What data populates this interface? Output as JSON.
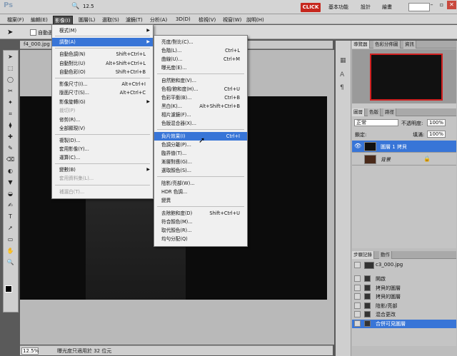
{
  "app": {
    "logo": "Ps",
    "zoom_value": "12.5",
    "click_label": "CLICK",
    "workspaces": [
      "基本功能",
      "設計",
      "繪畫"
    ]
  },
  "menubar": [
    "檔案(F)",
    "編輯(E)",
    "影像(I)",
    "圖層(L)",
    "選取(S)",
    "濾鏡(T)",
    "分析(A)",
    "3D(D)",
    "檢視(V)",
    "視窗(W)",
    "說明(H)"
  ],
  "options": {
    "auto_select": "自動選"
  },
  "document": {
    "tab": "f4_000.jpg @",
    "zoom": "12.5%",
    "status": "曝光度只適用於 32 位元"
  },
  "image_menu": [
    {
      "label": "模式(M)",
      "shortcut": "",
      "sub": true
    },
    {
      "label": "調整(A)",
      "shortcut": "",
      "sub": true,
      "hl": true
    },
    {
      "label": "自動色調(N)",
      "shortcut": "Shift+Ctrl+L"
    },
    {
      "label": "自動對比(U)",
      "shortcut": "Alt+Shift+Ctrl+L"
    },
    {
      "label": "自動色彩(O)",
      "shortcut": "Shift+Ctrl+B"
    },
    {
      "label": "影像尺寸(I)...",
      "shortcut": "Alt+Ctrl+I"
    },
    {
      "label": "版面尺寸(S)...",
      "shortcut": "Alt+Ctrl+C"
    },
    {
      "label": "影像旋轉(G)",
      "shortcut": "",
      "sub": true
    },
    {
      "label": "裁切(P)",
      "shortcut": "",
      "dis": true
    },
    {
      "label": "修剪(R)...",
      "shortcut": ""
    },
    {
      "label": "全部顯現(V)",
      "shortcut": ""
    },
    {
      "label": "複製(D)...",
      "shortcut": ""
    },
    {
      "label": "套用影像(Y)...",
      "shortcut": ""
    },
    {
      "label": "運算(C)...",
      "shortcut": ""
    },
    {
      "label": "變數(B)",
      "shortcut": "",
      "sub": true
    },
    {
      "label": "套用資料集(L)...",
      "shortcut": "",
      "dis": true
    },
    {
      "label": "補漏白(T)...",
      "shortcut": "",
      "dis": true
    }
  ],
  "adjust_menu": [
    {
      "label": "亮度/對比(C)...",
      "shortcut": ""
    },
    {
      "label": "色階(L)...",
      "shortcut": "Ctrl+L"
    },
    {
      "label": "曲線(U)...",
      "shortcut": "Ctrl+M"
    },
    {
      "label": "曝光度(E)...",
      "shortcut": ""
    },
    {
      "label": "自然飽和度(V)...",
      "shortcut": ""
    },
    {
      "label": "色相/飽和度(H)...",
      "shortcut": "Ctrl+U"
    },
    {
      "label": "色彩平衡(B)...",
      "shortcut": "Ctrl+B"
    },
    {
      "label": "黑白(K)...",
      "shortcut": "Alt+Shift+Ctrl+B"
    },
    {
      "label": "相片濾鏡(F)...",
      "shortcut": ""
    },
    {
      "label": "色版混合器(X)...",
      "shortcut": ""
    },
    {
      "label": "負片效果(I)",
      "shortcut": "Ctrl+I",
      "hl": true
    },
    {
      "label": "色調分離(P)...",
      "shortcut": ""
    },
    {
      "label": "臨界值(T)...",
      "shortcut": ""
    },
    {
      "label": "漸層對應(G)...",
      "shortcut": ""
    },
    {
      "label": "選取顏色(S)...",
      "shortcut": ""
    },
    {
      "label": "陰影/亮部(W)...",
      "shortcut": ""
    },
    {
      "label": "HDR 色調...",
      "shortcut": ""
    },
    {
      "label": "變異",
      "shortcut": ""
    },
    {
      "label": "去除飽和度(D)",
      "shortcut": "Shift+Ctrl+U"
    },
    {
      "label": "符合顏色(M)...",
      "shortcut": ""
    },
    {
      "label": "取代顏色(R)...",
      "shortcut": ""
    },
    {
      "label": "均勻分配(Q)",
      "shortcut": ""
    }
  ],
  "panels": {
    "nav_tabs": [
      "導覽器",
      "色彩分佈圖",
      "資訊"
    ],
    "layer_tabs": [
      "圖層",
      "色版",
      "路徑"
    ],
    "blend_mode": "正常",
    "opacity_label": "不透明度:",
    "opacity": "100%",
    "lock_label": "鎖定:",
    "fill_label": "填滿:",
    "fill": "100%",
    "layers": [
      {
        "name": "圖層 1 拷貝",
        "selected": true
      },
      {
        "name": "背景",
        "selected": false
      }
    ],
    "history_tabs": [
      "步驟記錄",
      "動作"
    ],
    "history_snapshot": "c3_000.jpg",
    "history": [
      {
        "name": "開啟",
        "selected": false
      },
      {
        "name": "拷貝的圖層",
        "selected": false
      },
      {
        "name": "拷貝的圖層",
        "selected": false
      },
      {
        "name": "陰影/亮部",
        "selected": false
      },
      {
        "name": "混合更改",
        "selected": false
      },
      {
        "name": "合併可見圖層",
        "selected": true
      }
    ]
  }
}
